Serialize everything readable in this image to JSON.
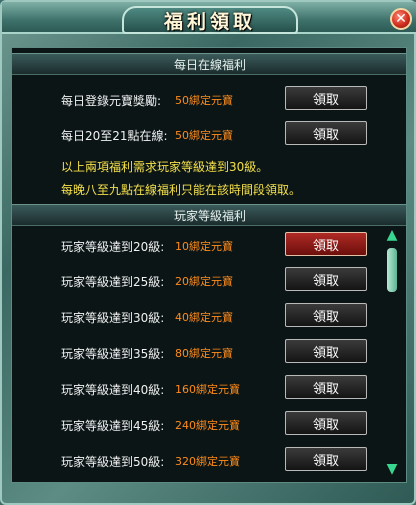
{
  "window": {
    "title": "福利領取",
    "close_glyph": "✕"
  },
  "daily": {
    "header": "每日在線福利",
    "rows": [
      {
        "label": "每日登錄元寶獎勵:",
        "reward": "50綁定元寶",
        "button": "領取"
      },
      {
        "label": "每日20至21點在線:",
        "reward": "50綁定元寶",
        "button": "領取"
      }
    ],
    "notes": [
      "以上兩項福利需求玩家等級達到30級。",
      "每晚八至九點在線福利只能在該時間段領取。"
    ]
  },
  "level": {
    "header": "玩家等級福利",
    "rows": [
      {
        "label": "玩家等級達到20級:",
        "reward": "10綁定元寶",
        "button": "領取",
        "active": true
      },
      {
        "label": "玩家等級達到25級:",
        "reward": "20綁定元寶",
        "button": "領取",
        "active": false
      },
      {
        "label": "玩家等級達到30級:",
        "reward": "40綁定元寶",
        "button": "領取",
        "active": false
      },
      {
        "label": "玩家等級達到35級:",
        "reward": "80綁定元寶",
        "button": "領取",
        "active": false
      },
      {
        "label": "玩家等級達到40級:",
        "reward": "160綁定元寶",
        "button": "領取",
        "active": false
      },
      {
        "label": "玩家等級達到45級:",
        "reward": "240綁定元寶",
        "button": "領取",
        "active": false
      },
      {
        "label": "玩家等級達到50級:",
        "reward": "320綁定元寶",
        "button": "領取",
        "active": false
      }
    ]
  },
  "scrollbar": {
    "up_glyph": "▲",
    "down_glyph": "▼"
  },
  "colors": {
    "reward": "#ff8c1a",
    "note": "#f4e04a",
    "active_button": "#b02a25",
    "scroll_arrow": "#39d68f"
  }
}
